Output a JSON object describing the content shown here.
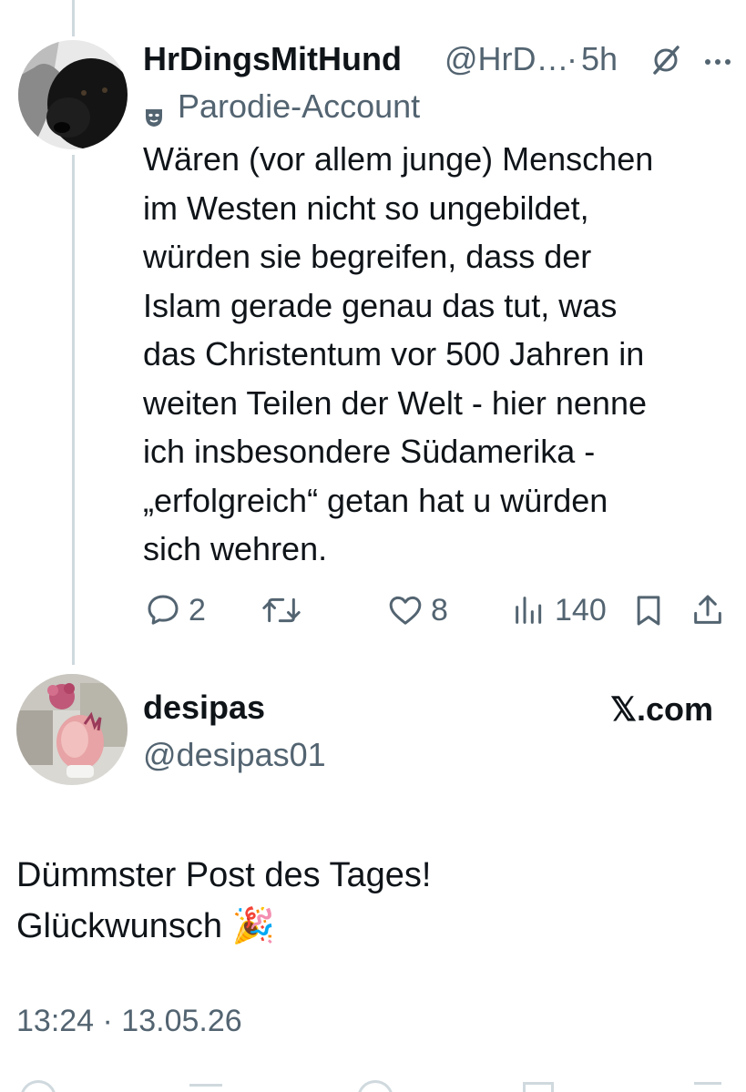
{
  "post": {
    "display_name": "HrDingsMitHund",
    "handle": "@HrD…",
    "separator": "·",
    "time": "5h",
    "label_icon": "mask-icon",
    "label": "Parodie-Account",
    "text": "Wären (vor allem junge) Menschen\nim Westen nicht so ungebildet,\nwürden sie begreifen, dass der\nIslam gerade genau das tut, was\ndas Christentum vor 500 Jahren in\nweiten Teilen der Welt - hier nenne\nich insbesondere Südamerika -\n„erfolgreich“ getan hat u würden\nsich wehren.",
    "actions": {
      "replies": "2",
      "retweets": "",
      "likes": "8",
      "views": "140"
    }
  },
  "reply": {
    "display_name": "desipas",
    "handle": "@desipas01",
    "brand": "𝕏.com",
    "text": "Dümmster Post des Tages!\nGlückwunsch 🎉",
    "timestamp": "13:24 · 13.05.26"
  },
  "colors": {
    "text": "#0f1419",
    "muted": "#536471",
    "thread_line": "#cfd9de"
  }
}
